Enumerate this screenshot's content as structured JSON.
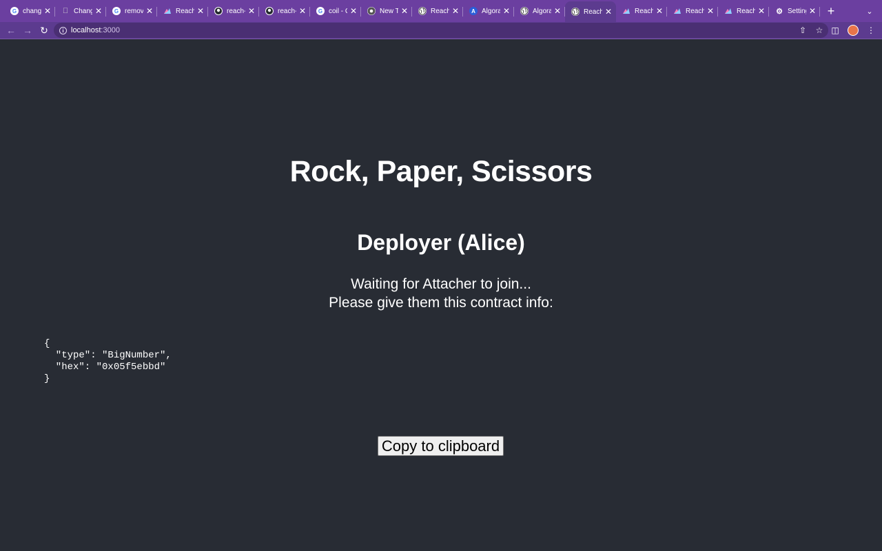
{
  "browser": {
    "tabs": [
      {
        "title": "change",
        "favicon": "google-icon",
        "active": false
      },
      {
        "title": "Chang",
        "favicon": "apple-icon",
        "active": false
      },
      {
        "title": "remove",
        "favicon": "google-icon",
        "active": false
      },
      {
        "title": "Reach",
        "favicon": "reach-icon",
        "active": false
      },
      {
        "title": "reach-",
        "favicon": "github-icon",
        "active": false
      },
      {
        "title": "reach-",
        "favicon": "github-icon",
        "active": false
      },
      {
        "title": "coil - G",
        "favicon": "google-icon",
        "active": false
      },
      {
        "title": "New Ta",
        "favicon": "chrome-icon",
        "active": false
      },
      {
        "title": "Reach",
        "favicon": "globe-icon",
        "active": false
      },
      {
        "title": "Algora",
        "favicon": "algorand-icon",
        "active": false
      },
      {
        "title": "Algora",
        "favicon": "globe-icon",
        "active": false
      },
      {
        "title": "Reach",
        "favicon": "globe-icon",
        "active": true
      },
      {
        "title": "Reach",
        "favicon": "reach-icon",
        "active": false
      },
      {
        "title": "Reach",
        "favicon": "reach-icon",
        "active": false
      },
      {
        "title": "Reach",
        "favicon": "reach-icon",
        "active": false
      },
      {
        "title": "Setting",
        "favicon": "gear-icon",
        "active": false
      }
    ],
    "url_host": "localhost",
    "url_port": ":3000",
    "theme_color": "#6b3fa0"
  },
  "page": {
    "title": "Rock, Paper, Scissors",
    "role": "Deployer (Alice)",
    "waiting_line": "Waiting for Attacher to join...",
    "instruction_line": "Please give them this contract info:",
    "contract_info": "{\n  \"type\": \"BigNumber\",\n  \"hex\": \"0x05f5ebbd\"\n}",
    "copy_button": "Copy to clipboard",
    "background_color": "#282c34"
  }
}
